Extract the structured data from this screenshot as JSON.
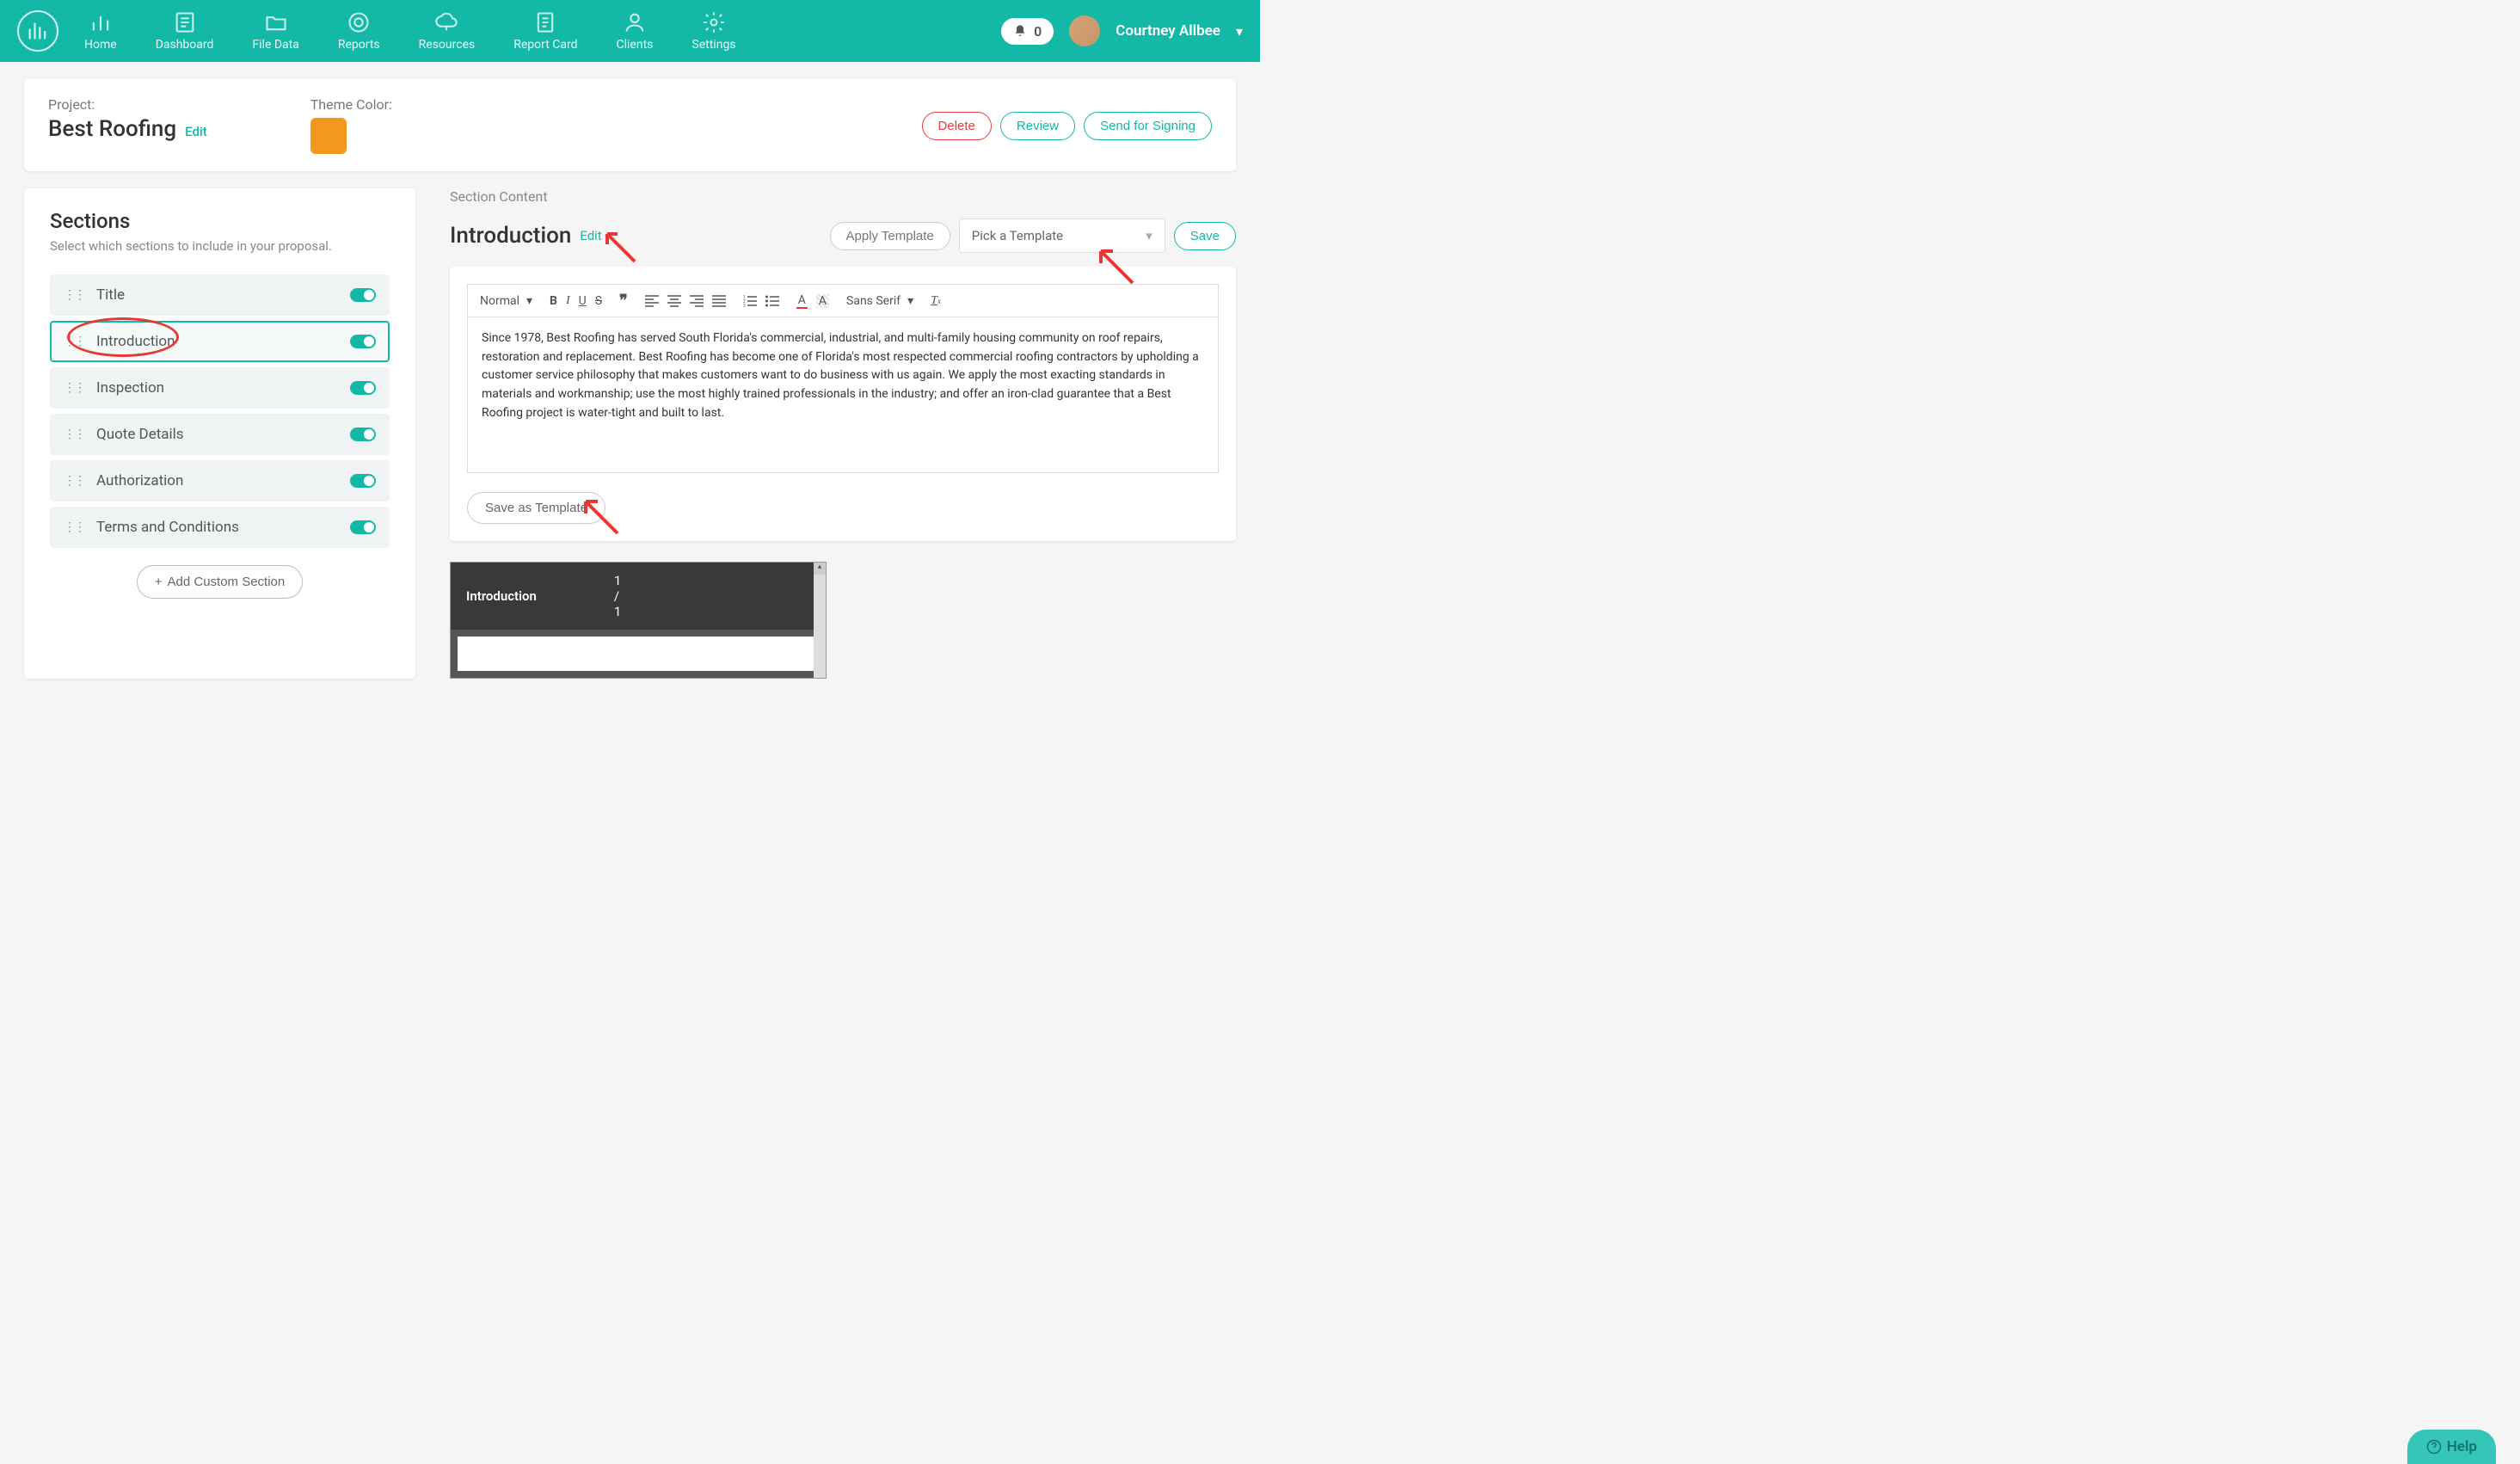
{
  "nav": {
    "items": [
      {
        "label": "Home"
      },
      {
        "label": "Dashboard"
      },
      {
        "label": "File Data"
      },
      {
        "label": "Reports"
      },
      {
        "label": "Resources"
      },
      {
        "label": "Report Card"
      },
      {
        "label": "Clients"
      },
      {
        "label": "Settings"
      }
    ],
    "notifications": "0",
    "user": "Courtney Allbee"
  },
  "project": {
    "label": "Project:",
    "name": "Best Roofing",
    "edit": "Edit",
    "theme_label": "Theme Color:",
    "theme_color": "#f2981d",
    "actions": {
      "delete": "Delete",
      "review": "Review",
      "send": "Send for Signing"
    }
  },
  "sections": {
    "title": "Sections",
    "subtitle": "Select which sections to include in your proposal.",
    "items": [
      {
        "name": "Title"
      },
      {
        "name": "Introduction"
      },
      {
        "name": "Inspection"
      },
      {
        "name": "Quote Details"
      },
      {
        "name": "Authorization"
      },
      {
        "name": "Terms and Conditions"
      }
    ],
    "add": "Add Custom Section"
  },
  "content": {
    "label": "Section Content",
    "title": "Introduction",
    "edit": "Edit",
    "apply": "Apply Template",
    "pick": "Pick a Template",
    "save": "Save",
    "format": "Normal",
    "font": "Sans Serif",
    "body": "Since 1978, Best Roofing has served South Florida's commercial, industrial, and multi-family housing community on roof repairs, restoration and replacement.  Best Roofing has become one of Florida's most respected commercial roofing contractors by upholding a customer service philosophy that makes customers want to do business with us again. We apply the most exacting standards in materials and workmanship; use the most highly trained professionals in the industry; and offer an iron-clad guarantee that a Best Roofing project is water-tight and built to last.",
    "save_template": "Save as Template"
  },
  "pdf": {
    "title": "Introduction",
    "page": "1 / 1"
  },
  "help": "Help"
}
